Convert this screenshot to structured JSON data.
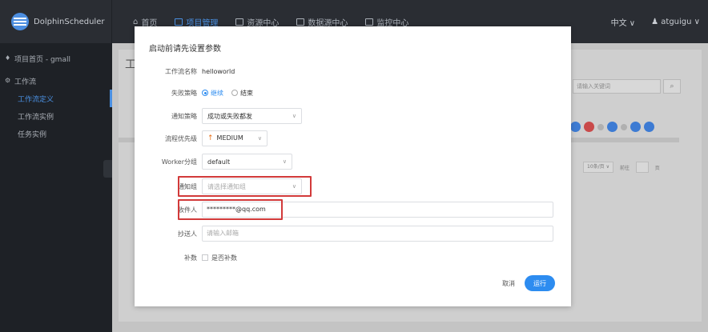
{
  "app": {
    "logo_text": "DolphinScheduler",
    "nav": [
      {
        "label": "首页",
        "active": false
      },
      {
        "label": "项目管理",
        "active": true
      },
      {
        "label": "资源中心",
        "active": false
      },
      {
        "label": "数据源中心",
        "active": false
      },
      {
        "label": "监控中心",
        "active": false
      }
    ],
    "language": "中文",
    "user": "atguigu"
  },
  "sidebar": {
    "project": "项目首页 - gmall",
    "group": "工作流",
    "items": [
      {
        "label": "工作流定义",
        "active": true
      },
      {
        "label": "工作流实例",
        "active": false
      },
      {
        "label": "任务实例",
        "active": false
      }
    ]
  },
  "background": {
    "title": "工",
    "search_placeholder": "请输入关键词",
    "pager": {
      "page_size": "10条/页",
      "goto": "前往",
      "page_unit": "页"
    }
  },
  "modal": {
    "title": "启动前请先设置参数",
    "workflow_name_label": "工作流名称",
    "workflow_name": "helloworld",
    "failure_strategy_label": "失败策略",
    "failure_options": [
      {
        "label": "继续",
        "checked": true
      },
      {
        "label": "结束",
        "checked": false
      }
    ],
    "notify_strategy_label": "通知策略",
    "notify_strategy_value": "成功或失败都发",
    "priority_label": "流程优先级",
    "priority_value": "MEDIUM",
    "worker_group_label": "Worker分组",
    "worker_group_value": "default",
    "notify_group_label": "通知组",
    "notify_group_placeholder": "请选择通知组",
    "recipients_label": "收件人",
    "recipient_value": "*********@qq.com",
    "cc_label": "抄送人",
    "cc_placeholder": "请输入邮箱",
    "complement_label": "补数",
    "complement_checkbox_label": "是否补数",
    "cancel_label": "取消",
    "run_label": "运行"
  },
  "colors": {
    "primary": "#2d8cf0",
    "highlight": "#d23a3a",
    "topbar": "#2a2d33",
    "sidebar": "#1e2126",
    "priority_arrow": "#e8701a"
  }
}
